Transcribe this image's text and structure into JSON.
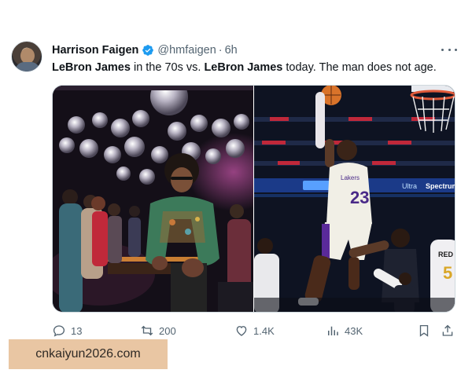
{
  "author": {
    "name": "Harrison Faigen",
    "handle": "@hmfaigen",
    "separator": "·",
    "time": "6h",
    "verified_color": "#1d9bf0"
  },
  "tweet": {
    "segments": [
      {
        "text": "LeBron James",
        "bold": true
      },
      {
        "text": " in the 70s vs. ",
        "bold": false
      },
      {
        "text": "LeBron James",
        "bold": true
      },
      {
        "text": " today. The man does not age.",
        "bold": false
      }
    ]
  },
  "media": {
    "left_jersey_number": "",
    "right_jersey_number": "23",
    "right_jersey_brand": "Lakers",
    "right_rival_jersey": "RED",
    "right_rival_number": "5",
    "ribbon_brand": "Spectrum",
    "ribbon_logo": "Ultra"
  },
  "actions": {
    "replies": "13",
    "reposts": "200",
    "likes": "1.4K",
    "views": "43K"
  },
  "icons": {
    "reply": "reply-icon",
    "repost": "repost-icon",
    "like": "like-icon",
    "views": "views-icon",
    "bookmark": "bookmark-icon",
    "share": "share-icon",
    "more": "more-icon",
    "verified": "verified-badge-icon"
  },
  "watermark": {
    "text": "cnkaiyun2026.com"
  }
}
